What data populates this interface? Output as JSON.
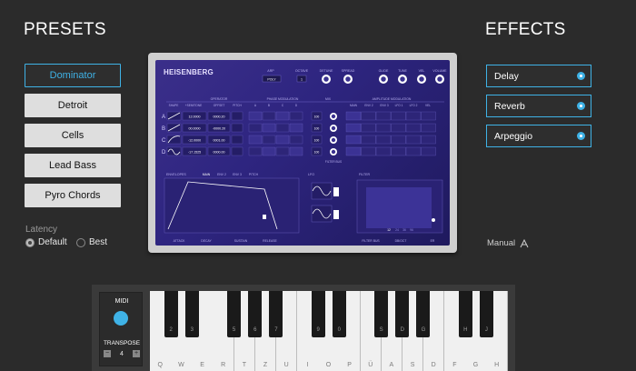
{
  "presets": {
    "title": "PRESETS",
    "items": [
      "Dominator",
      "Detroit",
      "Cells",
      "Lead Bass",
      "Pyro Chords"
    ],
    "selected": "Dominator"
  },
  "latency": {
    "label": "Latency",
    "options": [
      "Default",
      "Best"
    ],
    "selected": "Default"
  },
  "effects": {
    "title": "EFFECTS",
    "items": [
      "Delay",
      "Reverb",
      "Arpeggio"
    ]
  },
  "manual": {
    "label": "Manual"
  },
  "synth": {
    "name": "HEISENBERG",
    "top_labels": [
      "ARP",
      "OCTAVE",
      "DETUNE",
      "SPREAD",
      "GLIDE",
      "TUNE",
      "VEL",
      "VOLUME"
    ],
    "arp_value": "POLY",
    "octave_value": "1",
    "section_labels": [
      "OPERATOR",
      "PHASE MODULATION",
      "MIX",
      "AMPLITUDE MODULATION"
    ],
    "operator_headers": [
      "SHAPE",
      "+SEMITONE",
      "OFFSET",
      "PITCH"
    ],
    "phase_headers": [
      "A",
      "B",
      "C",
      "D"
    ],
    "amp_headers": [
      "MAIN",
      "ENV 2",
      "ENV 3",
      "LFO 1",
      "LFO 2",
      "VEL"
    ],
    "operators": [
      {
        "name": "A",
        "semitone": "12.0000",
        "offset": "0000.20",
        "mix": "100"
      },
      {
        "name": "B",
        "semitone": "00.0000",
        "offset": "-0000.20",
        "mix": "100"
      },
      {
        "name": "C",
        "semitone": "-12.0000",
        "offset": "0001.00",
        "mix": "100"
      },
      {
        "name": "D",
        "semitone": "-17.1525",
        "offset": "0000.00",
        "mix": "100"
      }
    ],
    "filter_bus": "FILTER BUS",
    "envelopes_label": "ENVELOPES",
    "env_tabs": [
      "MAIN",
      "ENV 2",
      "ENV 3",
      "PITCH"
    ],
    "env_footer": [
      "ATTACK",
      "DECAY",
      "SUSTAIN",
      "RELEASE"
    ],
    "lfo_label": "LFO",
    "filter_label": "FILTER",
    "filter_footer": [
      "FILTER BUS",
      "DB/OCT",
      "ER"
    ],
    "filter_slopes": [
      "12",
      "24",
      "36",
      "96"
    ]
  },
  "keyboard": {
    "midi_label": "MIDI",
    "transpose_label": "TRANSPOSE",
    "transpose_minus": "−",
    "transpose_plus": "+",
    "transpose_value": "4",
    "white_keys": [
      "Q",
      "W",
      "E",
      "R",
      "T",
      "Z",
      "U",
      "I",
      "O",
      "P",
      "Ü",
      "A",
      "S",
      "D",
      "F",
      "G",
      "H"
    ],
    "black_keys": [
      "2",
      "3",
      "5",
      "6",
      "7",
      "9",
      "0",
      "S",
      "D",
      "G",
      "H",
      "J"
    ]
  },
  "colors": {
    "accent": "#3fb2e6",
    "synth_bg": "#2e2580"
  }
}
